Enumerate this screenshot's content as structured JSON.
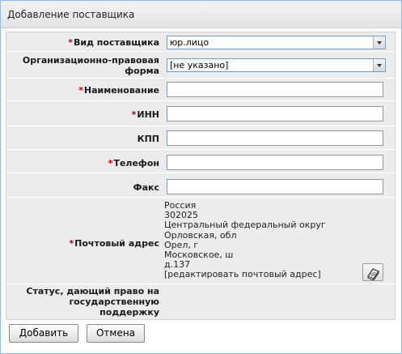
{
  "dialog": {
    "title": "Добавление поставщика"
  },
  "form": {
    "required_mark": "*",
    "supplier_type": {
      "label": "Вид поставщика",
      "value": "юр.лицо"
    },
    "legal_form": {
      "label_line1": "Организационно-правовая",
      "label_line2": "форма",
      "value": "[не указано]"
    },
    "name": {
      "label": "Наименование",
      "value": ""
    },
    "inn": {
      "label": "ИНН",
      "value": ""
    },
    "kpp": {
      "label": "КПП",
      "value": ""
    },
    "phone": {
      "label": "Телефон",
      "value": ""
    },
    "fax": {
      "label": "Факс",
      "value": ""
    },
    "postal_address": {
      "label": "Почтовый адрес",
      "lines": [
        "Россия",
        "302025",
        "Центральный федеральный округ",
        "Орловская, обл",
        "Орел, г",
        "Московское, ш",
        "д.137"
      ],
      "edit_link": "[редактировать почтовый адрес]"
    },
    "status": {
      "label_line1": "Статус, дающий право на",
      "label_line2": "государственную",
      "label_line3": "поддержку",
      "icon": "address-book-icon"
    }
  },
  "buttons": {
    "add": "Добавить",
    "cancel": "Отмена"
  },
  "colors": {
    "required": "#cc0000",
    "field_border": "#7f9db9",
    "form_background": "#ececec"
  }
}
